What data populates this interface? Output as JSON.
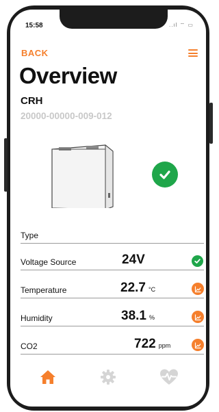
{
  "status_bar": {
    "time": "15:58",
    "icons": "..ıl ⌔ ▭"
  },
  "header": {
    "back_label": "BACK",
    "menu_icon": "hamburger-menu-icon"
  },
  "overview": {
    "title": "Overview",
    "device_type": "CRH",
    "serial": "20000-00000-009-012",
    "status_icon": "check-circle-icon"
  },
  "table": {
    "header_label": "Type",
    "rows": [
      {
        "label": "Voltage Source",
        "value": "24V",
        "unit": "",
        "icon": "check-circle-icon"
      },
      {
        "label": "Temperature",
        "value": "22.7",
        "unit": "°C",
        "icon": "chart-icon"
      },
      {
        "label": "Humidity",
        "value": "38.1",
        "unit": "%",
        "icon": "chart-icon"
      },
      {
        "label": "CO2",
        "value": "722",
        "unit": "ppm",
        "icon": "chart-icon"
      }
    ]
  },
  "tabbar": {
    "items": [
      {
        "name": "home",
        "icon": "home-icon",
        "active": true
      },
      {
        "name": "settings",
        "icon": "gear-icon",
        "active": false
      },
      {
        "name": "health",
        "icon": "heart-pulse-icon",
        "active": false
      }
    ]
  },
  "colors": {
    "accent": "#f57f2c",
    "success": "#1fa64a",
    "muted": "#c8c8c8",
    "inactive_icon": "#d5d5d5"
  }
}
